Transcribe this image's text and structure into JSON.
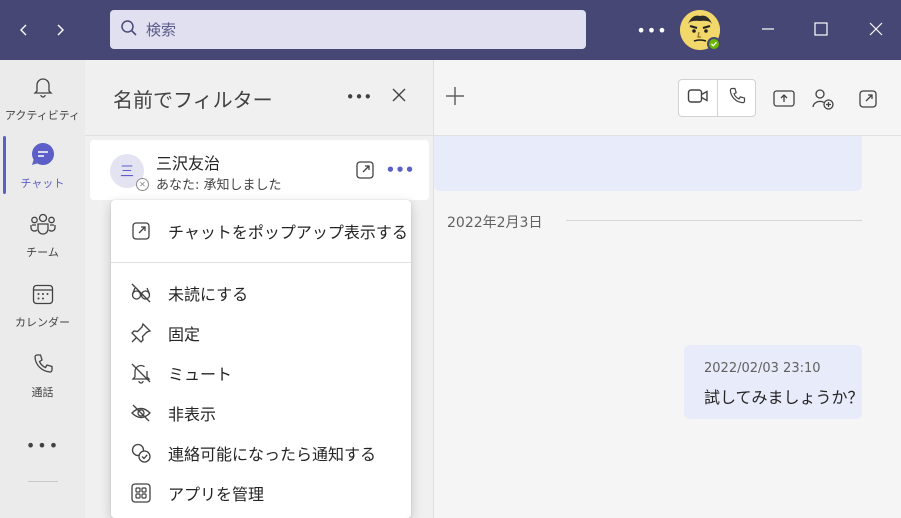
{
  "window": {
    "back_icon": "chevron-left-icon",
    "forward_icon": "chevron-right-icon",
    "more_icon": "more-horizontal-icon",
    "minimize_icon": "minimize-icon",
    "maximize_icon": "maximize-icon",
    "close_icon": "close-icon"
  },
  "search": {
    "placeholder": "検索",
    "icon": "search-icon"
  },
  "colors": {
    "titlebar": "#464775",
    "accent": "#5b5fc7",
    "bubble": "#e8ebfa",
    "presence_available": "#6bb700"
  },
  "rail": {
    "items": [
      {
        "label": "アクティビティ",
        "icon": "bell-icon"
      },
      {
        "label": "チャット",
        "icon": "chat-icon",
        "active": true
      },
      {
        "label": "チーム",
        "icon": "teams-icon"
      },
      {
        "label": "カレンダー",
        "icon": "calendar-icon"
      },
      {
        "label": "通話",
        "icon": "phone-icon"
      }
    ],
    "more_icon": "more-horizontal-icon"
  },
  "list_panel": {
    "title": "名前でフィルター",
    "chat": {
      "name": "三沢友治",
      "preview": "あなた: 承知しました"
    }
  },
  "context_menu": {
    "items": [
      {
        "label": "チャットをポップアップ表示する",
        "icon": "popout-icon"
      },
      {
        "label": "未読にする",
        "icon": "eye-off-icon"
      },
      {
        "label": "固定",
        "icon": "pin-icon"
      },
      {
        "label": "ミュート",
        "icon": "bell-off-icon"
      },
      {
        "label": "非表示",
        "icon": "eye-hide-icon"
      },
      {
        "label": "連絡可能になったら通知する",
        "icon": "notify-available-icon"
      },
      {
        "label": "アプリを管理",
        "icon": "apps-icon"
      }
    ]
  },
  "conversation": {
    "date_separator": "2022年2月3日",
    "message": {
      "timestamp": "2022/02/03 23:10",
      "text": "試してみましょうか？"
    }
  }
}
